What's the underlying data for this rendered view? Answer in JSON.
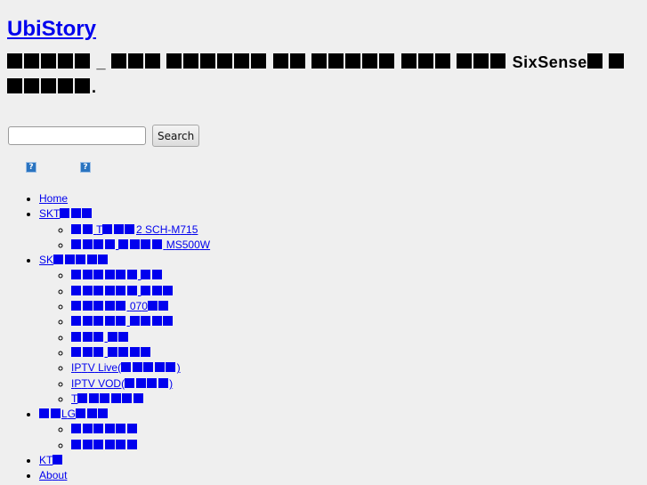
{
  "site": {
    "title": "UbiStory",
    "tagline": "■■■■■ _ ■■■ ■■■■■■ ■■ ■■■■■ ■■■ ■■■ SixSense■ ■ ■■■■■."
  },
  "search": {
    "input_value": "",
    "placeholder": "",
    "button_label": "Search"
  },
  "icons": [
    {
      "name": "broken-image-icon",
      "glyph": "?"
    },
    {
      "name": "broken-image-icon",
      "glyph": "?"
    }
  ],
  "menu": [
    {
      "label": "Home",
      "children": []
    },
    {
      "label": "SKT■■■",
      "children": [
        {
          "label": "■■ T■■■2 SCH-M715"
        },
        {
          "label": "■■■■ ■■■■ MS500W"
        }
      ]
    },
    {
      "label": "SK■■■■■",
      "children": [
        {
          "label": "■■■■■■ ■■"
        },
        {
          "label": "■■■■■■ ■■■"
        },
        {
          "label": "■■■■■ 070■■"
        },
        {
          "label": "■■■■■ ■■■■"
        },
        {
          "label": "■■■ ■■"
        },
        {
          "label": "■■■ ■■■■"
        },
        {
          "label": "IPTV Live(■■■■■)"
        },
        {
          "label": "IPTV VOD(■■■■)"
        },
        {
          "label": "T■■■■■■"
        }
      ]
    },
    {
      "label": "■■LG■■■",
      "children": [
        {
          "label": "■■■■■■"
        },
        {
          "label": "■■■■■■"
        }
      ]
    },
    {
      "label": "KT■",
      "children": []
    },
    {
      "label": "About",
      "children": []
    }
  ]
}
